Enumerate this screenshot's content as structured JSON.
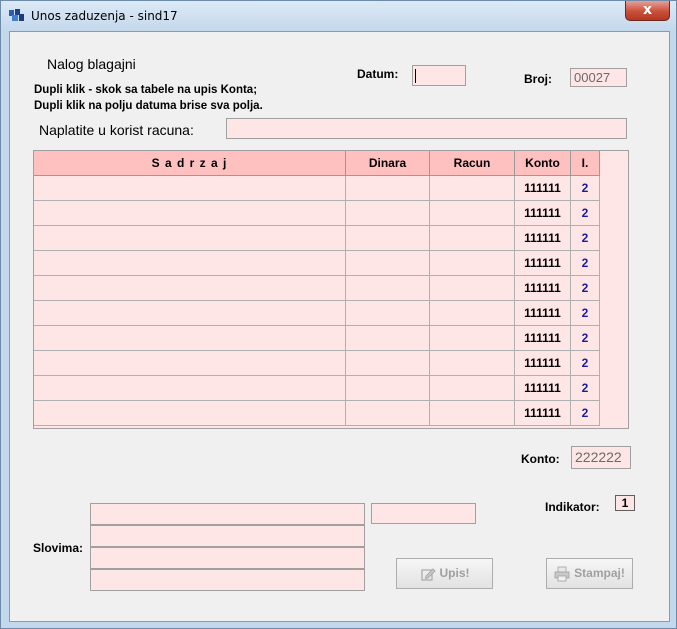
{
  "window": {
    "title": "Unos zaduzenja - sind17",
    "close_label": "x"
  },
  "form": {
    "heading": "Nalog blagajni",
    "hint1": "Dupli klik - skok sa tabele na upis Konta;",
    "hint2": "Dupli klik na polju datuma brise sva polja.",
    "datum_label": "Datum:",
    "datum_value": "",
    "broj_label": "Broj:",
    "broj_value": "00027",
    "naplatite_label": "Naplatite u korist racuna:",
    "naplatite_value": ""
  },
  "table": {
    "columns": [
      "S a d r z a j",
      "Dinara",
      "Racun",
      "Konto",
      "I."
    ],
    "rows": [
      {
        "sadrzaj": "",
        "dinara": "",
        "racun": "",
        "konto": "111111",
        "ind": "2"
      },
      {
        "sadrzaj": "",
        "dinara": "",
        "racun": "",
        "konto": "111111",
        "ind": "2"
      },
      {
        "sadrzaj": "",
        "dinara": "",
        "racun": "",
        "konto": "111111",
        "ind": "2"
      },
      {
        "sadrzaj": "",
        "dinara": "",
        "racun": "",
        "konto": "111111",
        "ind": "2"
      },
      {
        "sadrzaj": "",
        "dinara": "",
        "racun": "",
        "konto": "111111",
        "ind": "2"
      },
      {
        "sadrzaj": "",
        "dinara": "",
        "racun": "",
        "konto": "111111",
        "ind": "2"
      },
      {
        "sadrzaj": "",
        "dinara": "",
        "racun": "",
        "konto": "111111",
        "ind": "2"
      },
      {
        "sadrzaj": "",
        "dinara": "",
        "racun": "",
        "konto": "111111",
        "ind": "2"
      },
      {
        "sadrzaj": "",
        "dinara": "",
        "racun": "",
        "konto": "111111",
        "ind": "2"
      },
      {
        "sadrzaj": "",
        "dinara": "",
        "racun": "",
        "konto": "111111",
        "ind": "2"
      }
    ]
  },
  "bottom": {
    "konto_label": "Konto:",
    "konto_value": "222222",
    "indikator_label": "Indikator:",
    "indikator_value": "1",
    "slovima_label": "Slovima:",
    "slovima_lines": [
      "",
      "",
      "",
      ""
    ],
    "amount_value": "",
    "upis_label": "Upis!",
    "stampaj_label": "Stampaj!"
  },
  "colors": {
    "field_bg": "#ffe6e6",
    "header_bg": "#ffc0c0",
    "indicator_blue": "#1a1aa0",
    "close_red": "#c9503b"
  }
}
